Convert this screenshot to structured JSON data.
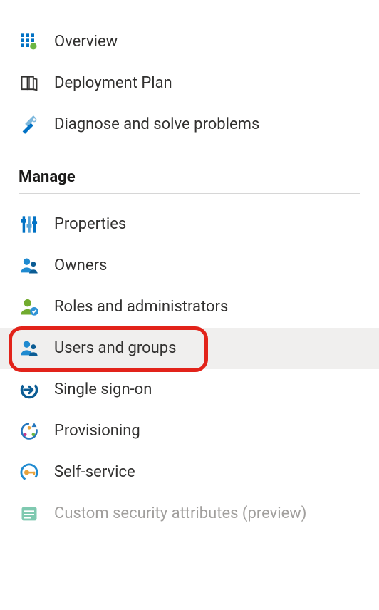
{
  "top_nav": {
    "items": [
      {
        "label": "Overview",
        "icon": "overview-grid-icon"
      },
      {
        "label": "Deployment Plan",
        "icon": "deployment-book-icon"
      },
      {
        "label": "Diagnose and solve problems",
        "icon": "diagnose-tools-icon"
      }
    ]
  },
  "manage_section": {
    "title": "Manage",
    "items": [
      {
        "label": "Properties",
        "icon": "properties-sliders-icon",
        "selected": false,
        "disabled": false
      },
      {
        "label": "Owners",
        "icon": "owners-people-icon",
        "selected": false,
        "disabled": false
      },
      {
        "label": "Roles and administrators",
        "icon": "roles-admin-icon",
        "selected": false,
        "disabled": false
      },
      {
        "label": "Users and groups",
        "icon": "users-groups-icon",
        "selected": true,
        "disabled": false
      },
      {
        "label": "Single sign-on",
        "icon": "sso-arrow-icon",
        "selected": false,
        "disabled": false
      },
      {
        "label": "Provisioning",
        "icon": "provisioning-sync-icon",
        "selected": false,
        "disabled": false
      },
      {
        "label": "Self-service",
        "icon": "self-service-key-icon",
        "selected": false,
        "disabled": false
      },
      {
        "label": "Custom security attributes (preview)",
        "icon": "security-attributes-icon",
        "selected": false,
        "disabled": true
      }
    ]
  },
  "highlight": {
    "target": "Users and groups"
  }
}
